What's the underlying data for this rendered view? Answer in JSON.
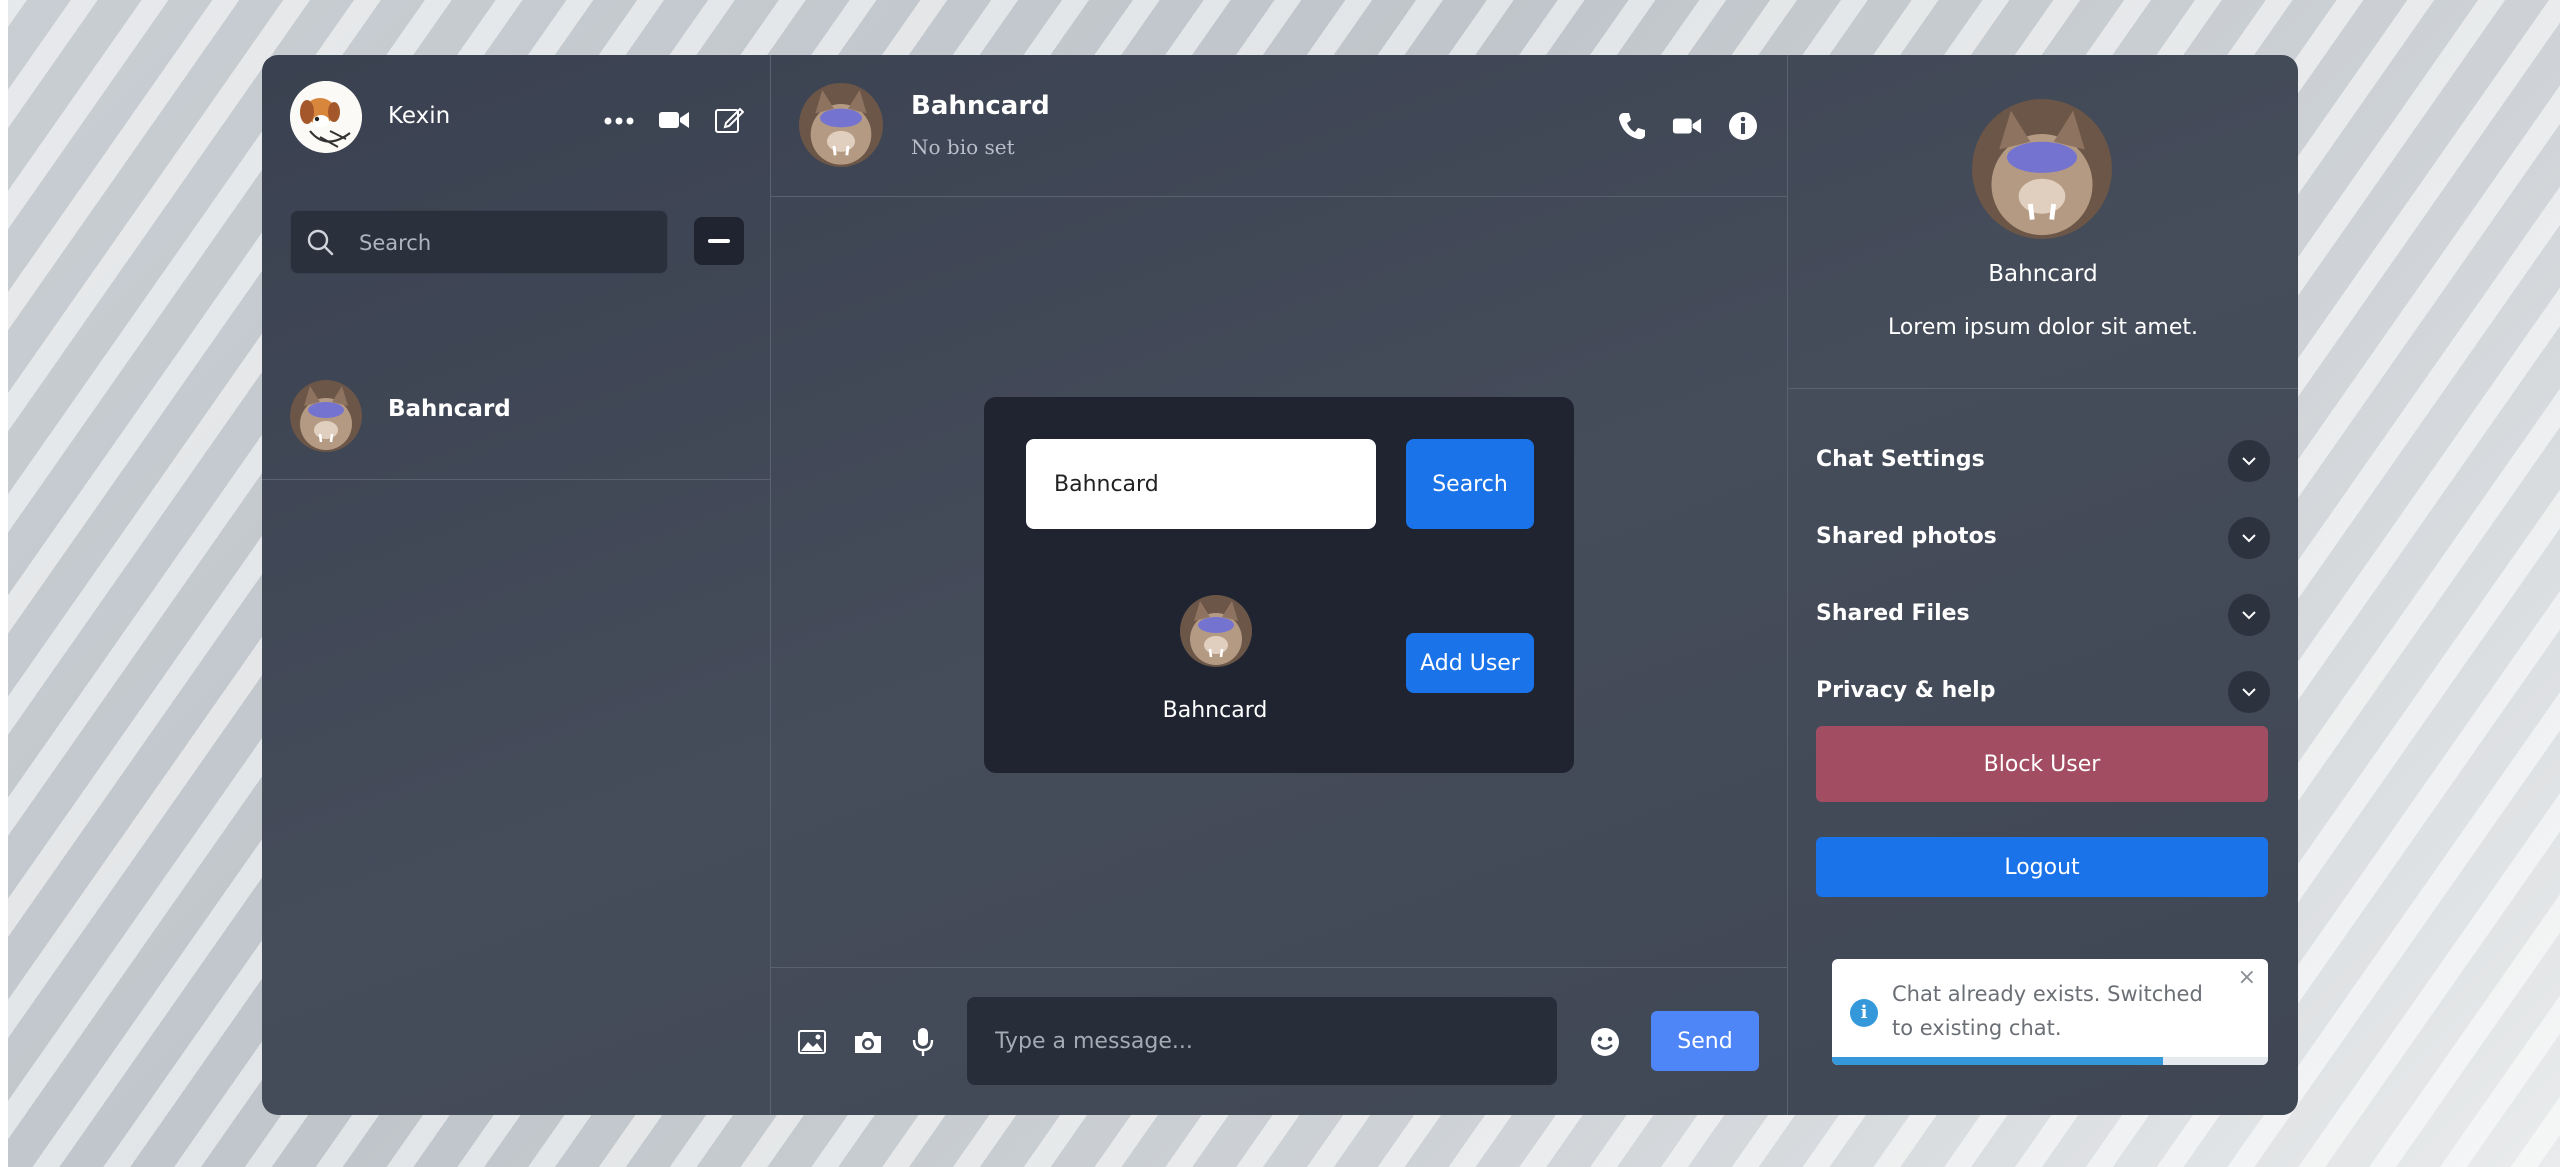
{
  "user": {
    "name": "Kexin"
  },
  "sidebar": {
    "search_placeholder": "Search",
    "chats": [
      {
        "name": "Bahncard"
      }
    ]
  },
  "chat": {
    "header_name": "Bahncard",
    "header_bio": "No bio set",
    "message_placeholder": "Type a message...",
    "send_label": "Send"
  },
  "add_user_modal": {
    "search_value": "Bahncard",
    "search_label": "Search",
    "result_name": "Bahncard",
    "add_label": "Add User"
  },
  "details": {
    "name": "Bahncard",
    "bio": "Lorem ipsum dolor sit amet.",
    "sections": [
      "Chat Settings",
      "Shared photos",
      "Shared Files",
      "Privacy & help"
    ],
    "block_label": "Block User",
    "logout_label": "Logout"
  },
  "toast": {
    "message": "Chat already exists. Switched to existing chat.",
    "close_label": "×",
    "progress": 0.76
  },
  "colors": {
    "accent": "#1a73e8",
    "send": "#4f86f7",
    "block": "#a34d62",
    "toast_info": "#3498db"
  }
}
